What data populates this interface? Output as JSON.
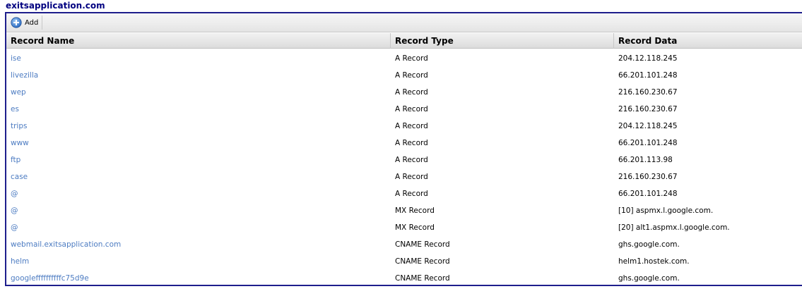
{
  "domain": "exitsapplication.com",
  "toolbar": {
    "add_label": "Add",
    "add_icon": "plus-circle-icon"
  },
  "columns": [
    "Record Name",
    "Record Type",
    "Record Data"
  ],
  "records": [
    {
      "name": "ise",
      "type": "A Record",
      "data": "204.12.118.245"
    },
    {
      "name": "livezilla",
      "type": "A Record",
      "data": "66.201.101.248"
    },
    {
      "name": "wep",
      "type": "A Record",
      "data": "216.160.230.67"
    },
    {
      "name": "es",
      "type": "A Record",
      "data": "216.160.230.67"
    },
    {
      "name": "trips",
      "type": "A Record",
      "data": "204.12.118.245"
    },
    {
      "name": "www",
      "type": "A Record",
      "data": "66.201.101.248"
    },
    {
      "name": "ftp",
      "type": "A Record",
      "data": "66.201.113.98"
    },
    {
      "name": "case",
      "type": "A Record",
      "data": "216.160.230.67"
    },
    {
      "name": "@",
      "type": "A Record",
      "data": "66.201.101.248"
    },
    {
      "name": "@",
      "type": "MX Record",
      "data": "[10] aspmx.l.google.com."
    },
    {
      "name": "@",
      "type": "MX Record",
      "data": "[20] alt1.aspmx.l.google.com."
    },
    {
      "name": "webmail.exitsapplication.com",
      "type": "CNAME Record",
      "data": "ghs.google.com."
    },
    {
      "name": "helm",
      "type": "CNAME Record",
      "data": "helm1.hostek.com."
    },
    {
      "name": "googleffffffffffc75d9e",
      "type": "CNAME Record",
      "data": "ghs.google.com."
    }
  ],
  "colors": {
    "title": "#000080",
    "border": "#1e1e8c",
    "link": "#4d7cc2",
    "icon": "#3a7fd5"
  }
}
